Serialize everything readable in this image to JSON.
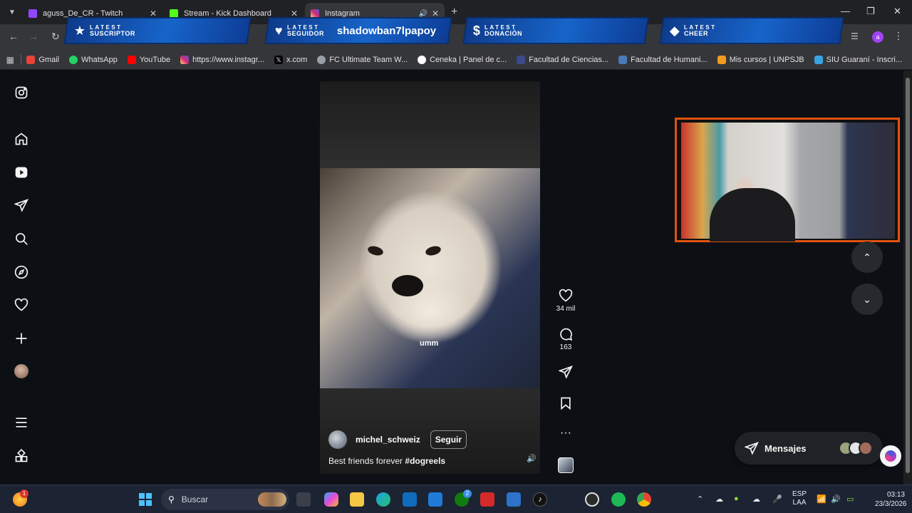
{
  "browser": {
    "tabs": [
      {
        "title": "aguss_De_CR - Twitch",
        "color": "#9146ff"
      },
      {
        "title": "Stream - Kick Dashboard",
        "color": "#53fc18"
      },
      {
        "title": "Instagram",
        "color": "#e1306c",
        "active": true
      }
    ],
    "profile_letter": "a"
  },
  "overlay_alerts": [
    {
      "top": "LATEST",
      "bottom": "SUSCRIPTOR",
      "icon": "star-icon",
      "name": ""
    },
    {
      "top": "LATEST",
      "bottom": "SEGUIDOR",
      "icon": "heart-icon",
      "name": "shadowban7lpapoy"
    },
    {
      "top": "LATEST",
      "bottom": "DONACIÓN",
      "icon": "dollar-icon",
      "name": ""
    },
    {
      "top": "LATEST",
      "bottom": "CHEER",
      "icon": "diamond-icon",
      "name": ""
    }
  ],
  "bookmarks": [
    {
      "label": "Gmail",
      "color": "#ea4335"
    },
    {
      "label": "WhatsApp",
      "color": "#25d366"
    },
    {
      "label": "YouTube",
      "color": "#ff0000"
    },
    {
      "label": "https://www.instagr...",
      "color": "#e1306c"
    },
    {
      "label": "x.com",
      "color": "#000000"
    },
    {
      "label": "FC Ultimate Team W...",
      "color": "#9aa0a6"
    },
    {
      "label": "Ceneka | Panel de c...",
      "color": "#ffffff"
    },
    {
      "label": "Facultad de Ciencias...",
      "color": "#3c4a8c"
    },
    {
      "label": "Facultad de Humani...",
      "color": "#4a7ab8"
    },
    {
      "label": "Mis cursos | UNPSJB",
      "color": "#f29b1d"
    },
    {
      "label": "SIU Guaraní - Inscri...",
      "color": "#3aa3e3"
    }
  ],
  "reel": {
    "overlay_text": "umm",
    "username": "michel_schweiz",
    "follow_label": "Seguir",
    "caption_text": "Best friends forever ",
    "caption_hashtag": "#dogreels",
    "likes": "34 mil",
    "comments": "163"
  },
  "messages": {
    "label": "Mensajes"
  },
  "taskbar": {
    "search_placeholder": "Buscar",
    "lang_line1": "ESP",
    "lang_line2": "LAA",
    "time": "03:13",
    "date": "23/3/2026",
    "notification_badge": "1",
    "xbox_badge": "2"
  }
}
